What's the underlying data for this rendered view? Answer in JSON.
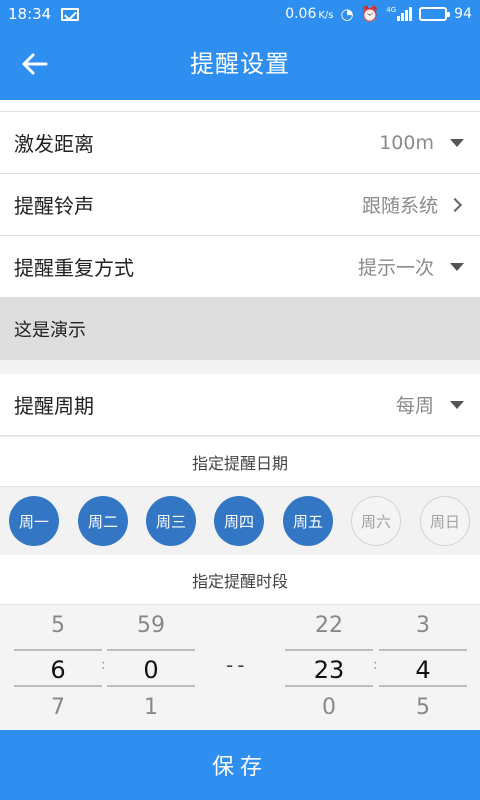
{
  "status_bar": {
    "time": "18:34",
    "speed": "0.06",
    "speed_unit": "K/s",
    "battery": "94",
    "network_label": "4G"
  },
  "app_bar": {
    "title": "提醒设置"
  },
  "settings": {
    "distance": {
      "label": "激发距离",
      "value": "100m"
    },
    "ringtone": {
      "label": "提醒铃声",
      "value": "跟随系统"
    },
    "repeat_mode": {
      "label": "提醒重复方式",
      "value": "提示一次"
    },
    "demo_text": "这是演示",
    "period": {
      "label": "提醒周期",
      "value": "每周"
    }
  },
  "date_section": {
    "title": "指定提醒日期",
    "days": [
      {
        "label": "周一",
        "selected": true
      },
      {
        "label": "周二",
        "selected": true
      },
      {
        "label": "周三",
        "selected": true
      },
      {
        "label": "周四",
        "selected": true
      },
      {
        "label": "周五",
        "selected": true
      },
      {
        "label": "周六",
        "selected": false
      },
      {
        "label": "周日",
        "selected": false
      }
    ]
  },
  "time_section": {
    "title": "指定提醒时段",
    "separator": "--",
    "start_hour": {
      "prev": "5",
      "current": "6",
      "next": "7"
    },
    "start_minute": {
      "prev": "59",
      "current": "0",
      "next": "1"
    },
    "end_hour": {
      "prev": "22",
      "current": "23",
      "next": "0"
    },
    "end_minute": {
      "prev": "3",
      "current": "4",
      "next": "5"
    }
  },
  "save_label": "保存",
  "colors": {
    "primary": "#2e8ff0",
    "day_selected": "#3377c4",
    "demo_background": "#dedede"
  }
}
